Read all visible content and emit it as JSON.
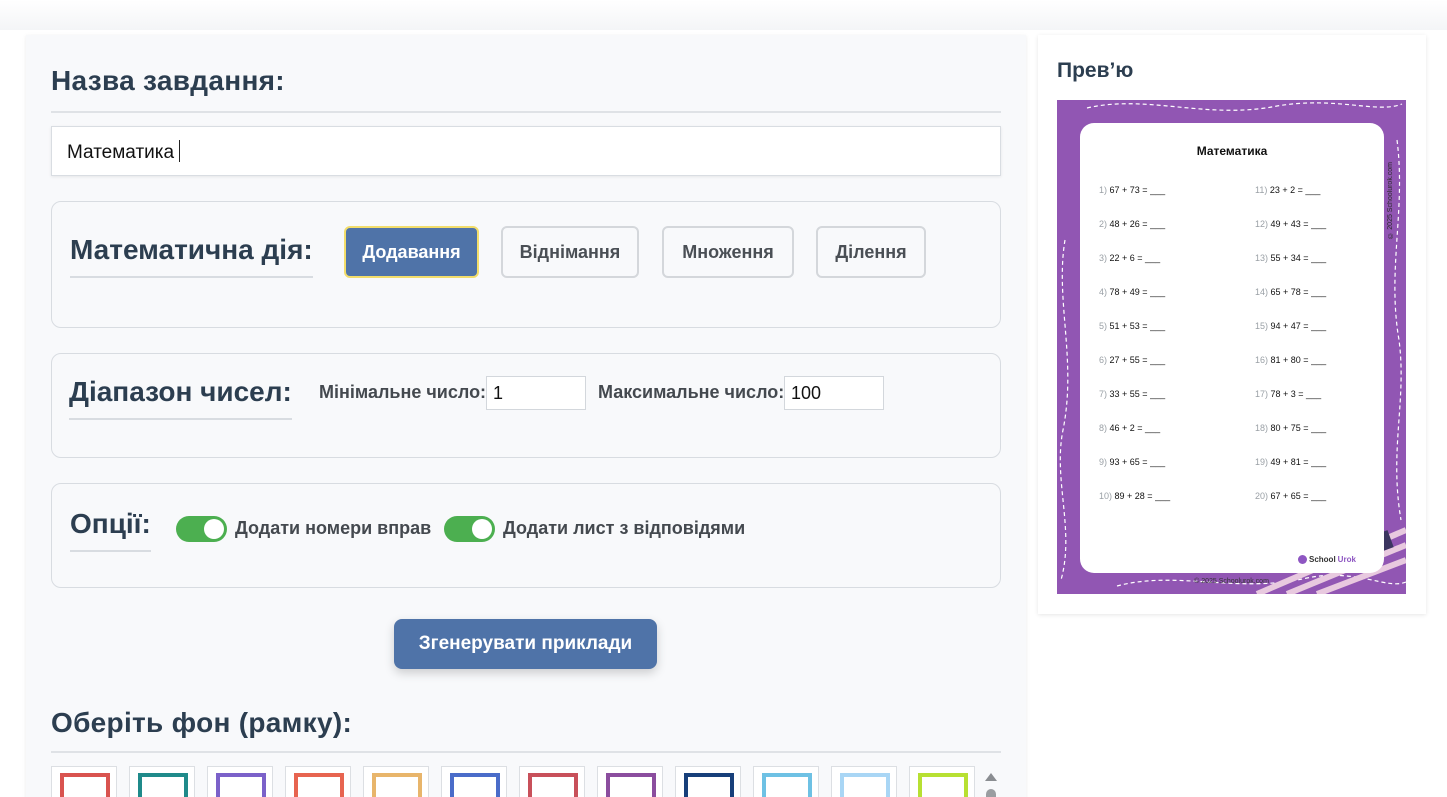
{
  "form": {
    "task_name_heading": "Назва завдання:",
    "task_name_value": "Математика",
    "operation": {
      "heading": "Математична дія:",
      "buttons": [
        "Додавання",
        "Віднімання",
        "Множення",
        "Ділення"
      ],
      "active": "Додавання"
    },
    "range": {
      "heading": "Діапазон чисел:",
      "min_label": "Мінімальне число:",
      "min_value": "1",
      "max_label": "Максимальне число:",
      "max_value": "100"
    },
    "options": {
      "heading": "Опції:",
      "toggle1_label": "Додати номери вправ",
      "toggle1_on": true,
      "toggle2_label": "Додати лист з відповідями",
      "toggle2_on": true
    },
    "generate_label": "Згенерувати приклади",
    "background": {
      "heading": "Оберіть фон (рамку):",
      "thumbnail_colors": [
        "#d9534f",
        "#1f8a8a",
        "#7b61c9",
        "#e76450",
        "#e8b56b",
        "#4a6cc9",
        "#c8505a",
        "#8b4d9e",
        "#173f7a",
        "#6ec1e4",
        "#a9d6f5",
        "#b7e032"
      ]
    }
  },
  "preview": {
    "title": "Прев’ю",
    "sheet_title": "Математика",
    "exercises_left": [
      {
        "n": "1)",
        "text": "67 + 73 = ___"
      },
      {
        "n": "2)",
        "text": "48 + 26 = ___"
      },
      {
        "n": "3)",
        "text": "22 + 6 = ___"
      },
      {
        "n": "4)",
        "text": "78 + 49 = ___"
      },
      {
        "n": "5)",
        "text": "51 + 53 = ___"
      },
      {
        "n": "6)",
        "text": "27 + 55 = ___"
      },
      {
        "n": "7)",
        "text": "33 + 55 = ___"
      },
      {
        "n": "8)",
        "text": "46 + 2 = ___"
      },
      {
        "n": "9)",
        "text": "93 + 65 = ___"
      },
      {
        "n": "10)",
        "text": "89 + 28 = ___"
      }
    ],
    "exercises_right": [
      {
        "n": "11)",
        "text": "23 + 2 = ___"
      },
      {
        "n": "12)",
        "text": "49 + 43 = ___"
      },
      {
        "n": "13)",
        "text": "55 + 34 = ___"
      },
      {
        "n": "14)",
        "text": "65 + 78 = ___"
      },
      {
        "n": "15)",
        "text": "94 + 47 = ___"
      },
      {
        "n": "16)",
        "text": "81 + 80 = ___"
      },
      {
        "n": "17)",
        "text": "78 + 3 = ___"
      },
      {
        "n": "18)",
        "text": "80 + 75 = ___"
      },
      {
        "n": "19)",
        "text": "49 + 81 = ___"
      },
      {
        "n": "20)",
        "text": "67 + 65 = ___"
      }
    ],
    "logo_school": "School",
    "logo_urok": "Urok",
    "copyright_bottom": "© 2025 Schoolurok.com",
    "copyright_side": "© 2025 Schoolurok.com",
    "sheet_color": "#9156b3"
  }
}
